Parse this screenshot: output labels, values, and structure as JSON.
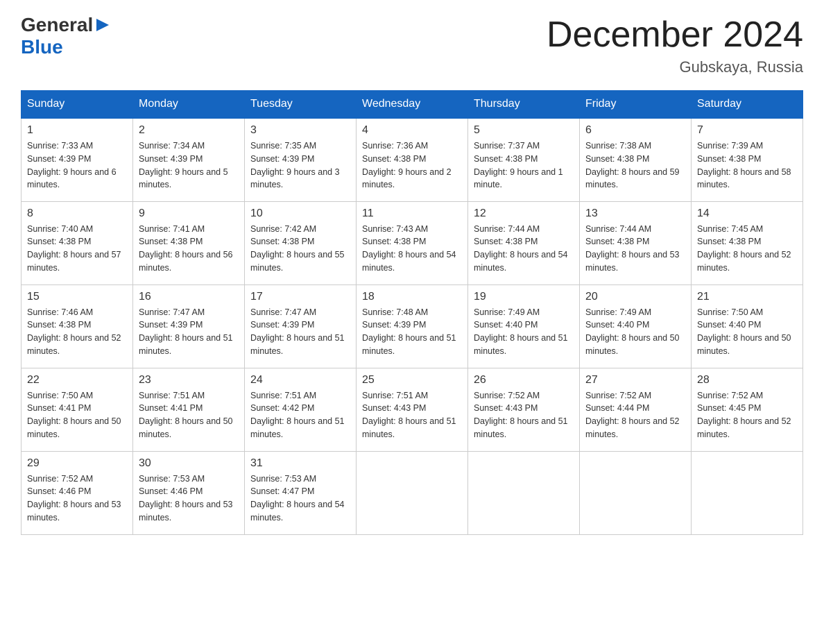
{
  "header": {
    "logo": {
      "text_general": "General",
      "text_blue": "Blue"
    },
    "title": "December 2024",
    "location": "Gubskaya, Russia"
  },
  "calendar": {
    "days_of_week": [
      "Sunday",
      "Monday",
      "Tuesday",
      "Wednesday",
      "Thursday",
      "Friday",
      "Saturday"
    ],
    "weeks": [
      [
        {
          "day": "1",
          "sunrise": "7:33 AM",
          "sunset": "4:39 PM",
          "daylight": "9 hours and 6 minutes."
        },
        {
          "day": "2",
          "sunrise": "7:34 AM",
          "sunset": "4:39 PM",
          "daylight": "9 hours and 5 minutes."
        },
        {
          "day": "3",
          "sunrise": "7:35 AM",
          "sunset": "4:39 PM",
          "daylight": "9 hours and 3 minutes."
        },
        {
          "day": "4",
          "sunrise": "7:36 AM",
          "sunset": "4:38 PM",
          "daylight": "9 hours and 2 minutes."
        },
        {
          "day": "5",
          "sunrise": "7:37 AM",
          "sunset": "4:38 PM",
          "daylight": "9 hours and 1 minute."
        },
        {
          "day": "6",
          "sunrise": "7:38 AM",
          "sunset": "4:38 PM",
          "daylight": "8 hours and 59 minutes."
        },
        {
          "day": "7",
          "sunrise": "7:39 AM",
          "sunset": "4:38 PM",
          "daylight": "8 hours and 58 minutes."
        }
      ],
      [
        {
          "day": "8",
          "sunrise": "7:40 AM",
          "sunset": "4:38 PM",
          "daylight": "8 hours and 57 minutes."
        },
        {
          "day": "9",
          "sunrise": "7:41 AM",
          "sunset": "4:38 PM",
          "daylight": "8 hours and 56 minutes."
        },
        {
          "day": "10",
          "sunrise": "7:42 AM",
          "sunset": "4:38 PM",
          "daylight": "8 hours and 55 minutes."
        },
        {
          "day": "11",
          "sunrise": "7:43 AM",
          "sunset": "4:38 PM",
          "daylight": "8 hours and 54 minutes."
        },
        {
          "day": "12",
          "sunrise": "7:44 AM",
          "sunset": "4:38 PM",
          "daylight": "8 hours and 54 minutes."
        },
        {
          "day": "13",
          "sunrise": "7:44 AM",
          "sunset": "4:38 PM",
          "daylight": "8 hours and 53 minutes."
        },
        {
          "day": "14",
          "sunrise": "7:45 AM",
          "sunset": "4:38 PM",
          "daylight": "8 hours and 52 minutes."
        }
      ],
      [
        {
          "day": "15",
          "sunrise": "7:46 AM",
          "sunset": "4:38 PM",
          "daylight": "8 hours and 52 minutes."
        },
        {
          "day": "16",
          "sunrise": "7:47 AM",
          "sunset": "4:39 PM",
          "daylight": "8 hours and 51 minutes."
        },
        {
          "day": "17",
          "sunrise": "7:47 AM",
          "sunset": "4:39 PM",
          "daylight": "8 hours and 51 minutes."
        },
        {
          "day": "18",
          "sunrise": "7:48 AM",
          "sunset": "4:39 PM",
          "daylight": "8 hours and 51 minutes."
        },
        {
          "day": "19",
          "sunrise": "7:49 AM",
          "sunset": "4:40 PM",
          "daylight": "8 hours and 51 minutes."
        },
        {
          "day": "20",
          "sunrise": "7:49 AM",
          "sunset": "4:40 PM",
          "daylight": "8 hours and 50 minutes."
        },
        {
          "day": "21",
          "sunrise": "7:50 AM",
          "sunset": "4:40 PM",
          "daylight": "8 hours and 50 minutes."
        }
      ],
      [
        {
          "day": "22",
          "sunrise": "7:50 AM",
          "sunset": "4:41 PM",
          "daylight": "8 hours and 50 minutes."
        },
        {
          "day": "23",
          "sunrise": "7:51 AM",
          "sunset": "4:41 PM",
          "daylight": "8 hours and 50 minutes."
        },
        {
          "day": "24",
          "sunrise": "7:51 AM",
          "sunset": "4:42 PM",
          "daylight": "8 hours and 51 minutes."
        },
        {
          "day": "25",
          "sunrise": "7:51 AM",
          "sunset": "4:43 PM",
          "daylight": "8 hours and 51 minutes."
        },
        {
          "day": "26",
          "sunrise": "7:52 AM",
          "sunset": "4:43 PM",
          "daylight": "8 hours and 51 minutes."
        },
        {
          "day": "27",
          "sunrise": "7:52 AM",
          "sunset": "4:44 PM",
          "daylight": "8 hours and 52 minutes."
        },
        {
          "day": "28",
          "sunrise": "7:52 AM",
          "sunset": "4:45 PM",
          "daylight": "8 hours and 52 minutes."
        }
      ],
      [
        {
          "day": "29",
          "sunrise": "7:52 AM",
          "sunset": "4:46 PM",
          "daylight": "8 hours and 53 minutes."
        },
        {
          "day": "30",
          "sunrise": "7:53 AM",
          "sunset": "4:46 PM",
          "daylight": "8 hours and 53 minutes."
        },
        {
          "day": "31",
          "sunrise": "7:53 AM",
          "sunset": "4:47 PM",
          "daylight": "8 hours and 54 minutes."
        },
        null,
        null,
        null,
        null
      ]
    ]
  }
}
